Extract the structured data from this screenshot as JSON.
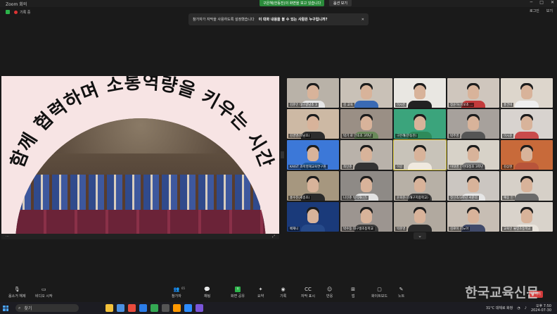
{
  "window": {
    "app_title": "Zoom 회의",
    "share_banner": "구은혜(한동진)의 화면을 보고 있습니다",
    "view_button": "옵션 보기",
    "controls": [
      "─",
      "□",
      "✕"
    ]
  },
  "topbar": {
    "recording_label": "기록 중",
    "right_items": [
      "로그인",
      "보기"
    ]
  },
  "notice": {
    "text": "참가자가 자막을 사용하도록 설정했습니다",
    "link": "이 대화 내용을 볼 수 있는 사람은 누구입니까?",
    "close": "✕"
  },
  "shared_screen": {
    "headline": "함께 협력하며 소통역량을 키우는 시간",
    "colors": {
      "background": "#f7e4e4",
      "text": "#111111"
    }
  },
  "gallery": {
    "tiles": [
      {
        "name": "김준인 대구광남초 3 ",
        "shirt": "#e6e6e6",
        "bg": "#b9b2a8"
      },
      {
        "name": "김 교육",
        "shirt": "#3a6ab4",
        "bg": "#c9c1b7"
      },
      {
        "name": "이사은",
        "shirt": "#222222",
        "bg": "#e9e7e2"
      },
      {
        "name": "정윤하(성모초 ...",
        "shirt": "#c33b3b",
        "bg": "#cfc6bd"
      },
      {
        "name": "홍건비 ",
        "shirt": "#efefef",
        "bg": "#ddd6cc"
      },
      {
        "name": "김경영(학남초)",
        "shirt": "#2d2d2d",
        "bg": "#cdb9a4"
      },
      {
        "name": "박기 로 안호초 3학년",
        "shirt": "#6a8a5a",
        "bg": "#9a8f85"
      },
      {
        "name": "구은혜(한동진)",
        "shirt": "#2e8b5a",
        "bg": "#3ba47c"
      },
      {
        "name": "박주영",
        "shirt": "#555555",
        "bg": "#a7a19c"
      },
      {
        "name": "이시윤",
        "shirt": "#c94b4b",
        "bg": "#d8d3cf"
      },
      {
        "name": "KAIST 과학영재교육연구원",
        "shirt": "#1c5aa0",
        "bg": "#3c78d8"
      },
      {
        "name": "최민준",
        "shirt": "#333333",
        "bg": "#b9b2aa"
      },
      {
        "name": "이강",
        "shirt": "#f0e9df",
        "bg": "#c8c3b9"
      },
      {
        "name": "이대영 인천대정초 3학년",
        "shirt": "#7a7a7a",
        "bg": "#d7d2c8"
      },
      {
        "name": "김상현",
        "shirt": "#b8543a",
        "bg": "#c86a3a"
      },
      {
        "name": "홍수진(세종초)",
        "shirt": "#2a2a2a",
        "bg": "#a6977f"
      },
      {
        "name": "나신준 박석재(산)",
        "shirt": "#e2e2e2",
        "bg": "#8e8a86"
      },
      {
        "name": "윤회준(김해구지중학교)",
        "shirt": "#3c3c3c",
        "bg": "#b7b0a6"
      },
      {
        "name": "정신조/3학년 서준의",
        "shirt": "#e6e6e6",
        "bg": "#cbc6c1"
      },
      {
        "name": "예승 인",
        "shirt": "#6a6a6a",
        "bg": "#d6d0c8"
      },
      {
        "name": "배재니",
        "shirt": "#264a8a",
        "bg": "#1a3a7a"
      },
      {
        "name": "박수동 대구생초등학교",
        "shirt": "#3a3a3a",
        "bg": "#9c9590"
      },
      {
        "name": "박준영",
        "shirt": "#2b2b2b",
        "bg": "#b1a99f"
      },
      {
        "name": "김로이 김노아",
        "shirt": "#404a6a",
        "bg": "#c7beb4"
      },
      {
        "name": "교육인 불렁초등학교",
        "shirt": "#e9e4dc",
        "bg": "#d9d3cb"
      }
    ],
    "active_tile": 12
  },
  "toolbar": {
    "items": [
      {
        "label": "음소거 해제",
        "icon": "microphone-muted-icon",
        "glyph": "🎙"
      },
      {
        "label": "비디오 시작",
        "icon": "video-off-icon",
        "glyph": "▭"
      },
      {
        "label": "참가자",
        "icon": "participants-icon",
        "glyph": "👥",
        "count": "65"
      },
      {
        "label": "채팅",
        "icon": "chat-icon",
        "glyph": "💬"
      },
      {
        "label": "화면 공유",
        "icon": "share-screen-icon",
        "glyph": "↑"
      },
      {
        "label": "요약",
        "icon": "summary-icon",
        "glyph": "✦"
      },
      {
        "label": "기록",
        "icon": "record-icon",
        "glyph": "◉"
      },
      {
        "label": "자막 표시",
        "icon": "captions-icon",
        "glyph": "CC"
      },
      {
        "label": "반응",
        "icon": "reactions-icon",
        "glyph": "☺"
      },
      {
        "label": "앱",
        "icon": "apps-icon",
        "glyph": "⊞"
      },
      {
        "label": "화이트보드",
        "icon": "whiteboard-icon",
        "glyph": "▢"
      },
      {
        "label": "노트",
        "icon": "notes-icon",
        "glyph": "✎"
      }
    ],
    "end_label": "나가기"
  },
  "watermark": "한국교육신문",
  "taskbar": {
    "search_placeholder": "찾기",
    "weather": "31°C 대체로 화창",
    "time": "오후 7:50",
    "date": "2024-07-30",
    "apps": [
      "#f3c13a",
      "#4a90e2",
      "#e94b3c",
      "#2b7de9",
      "#34a853",
      "#555555",
      "#ff9800",
      "#2d8cff",
      "#7a55d9"
    ]
  }
}
